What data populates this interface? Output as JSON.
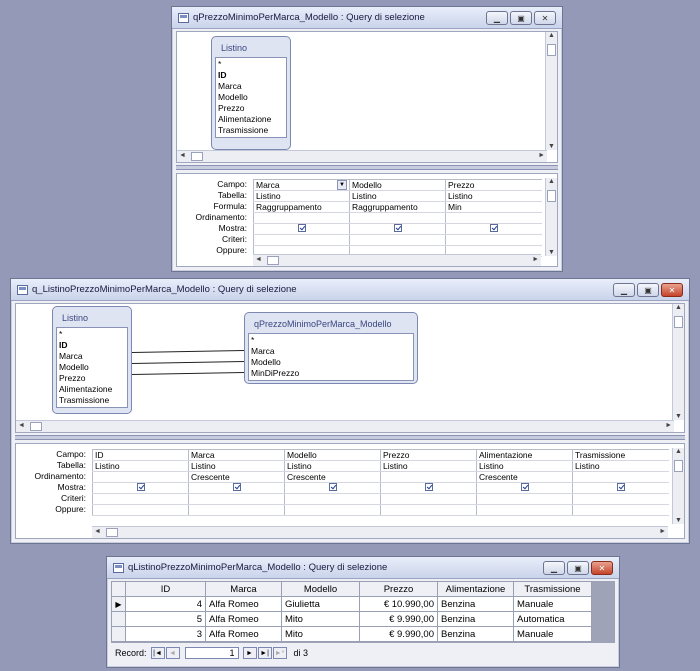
{
  "win1": {
    "title": "qPrezzoMinimoPerMarca_Modello : Query di selezione",
    "table": {
      "name": "Listino",
      "fields": [
        "*",
        "ID",
        "Marca",
        "Modello",
        "Prezzo",
        "Alimentazione",
        "Trasmissione"
      ]
    },
    "row_labels": [
      "Campo:",
      "Tabella:",
      "Formula:",
      "Ordinamento:",
      "Mostra:",
      "Criteri:",
      "Oppure:"
    ],
    "columns": [
      {
        "campo": "Marca",
        "tabella": "Listino",
        "formula": "Raggruppamento",
        "ordinamento": ""
      },
      {
        "campo": "Modello",
        "tabella": "Listino",
        "formula": "Raggruppamento",
        "ordinamento": ""
      },
      {
        "campo": "Prezzo",
        "tabella": "Listino",
        "formula": "Min",
        "ordinamento": ""
      }
    ]
  },
  "win2": {
    "title": "q_ListinoPrezzoMinimoPerMarca_Modello : Query di selezione",
    "table1": {
      "name": "Listino",
      "fields": [
        "*",
        "ID",
        "Marca",
        "Modello",
        "Prezzo",
        "Alimentazione",
        "Trasmissione"
      ]
    },
    "table2": {
      "name": "qPrezzoMinimoPerMarca_Modello",
      "fields": [
        "*",
        "Marca",
        "Modello",
        "MinDiPrezzo"
      ]
    },
    "row_labels": [
      "Campo:",
      "Tabella:",
      "Ordinamento:",
      "Mostra:",
      "Criteri:",
      "Oppure:"
    ],
    "columns": [
      {
        "campo": "ID",
        "tabella": "Listino",
        "ordinamento": ""
      },
      {
        "campo": "Marca",
        "tabella": "Listino",
        "ordinamento": "Crescente"
      },
      {
        "campo": "Modello",
        "tabella": "Listino",
        "ordinamento": "Crescente"
      },
      {
        "campo": "Prezzo",
        "tabella": "Listino",
        "ordinamento": ""
      },
      {
        "campo": "Alimentazione",
        "tabella": "Listino",
        "ordinamento": "Crescente"
      },
      {
        "campo": "Trasmissione",
        "tabella": "Listino",
        "ordinamento": ""
      }
    ]
  },
  "win3": {
    "title": "qListinoPrezzoMinimoPerMarca_Modello : Query di selezione",
    "headers": [
      "ID",
      "Marca",
      "Modello",
      "Prezzo",
      "Alimentazione",
      "Trasmissione"
    ],
    "rows": [
      [
        "4",
        "Alfa Romeo",
        "Giulietta",
        "€ 10.990,00",
        "Benzina",
        "Manuale"
      ],
      [
        "5",
        "Alfa Romeo",
        "Mito",
        "€ 9.990,00",
        "Benzina",
        "Automatica"
      ],
      [
        "3",
        "Alfa Romeo",
        "Mito",
        "€ 9.990,00",
        "Benzina",
        "Manuale"
      ]
    ],
    "record_label": "Record:",
    "record_current": "1",
    "record_total": "di 3"
  }
}
